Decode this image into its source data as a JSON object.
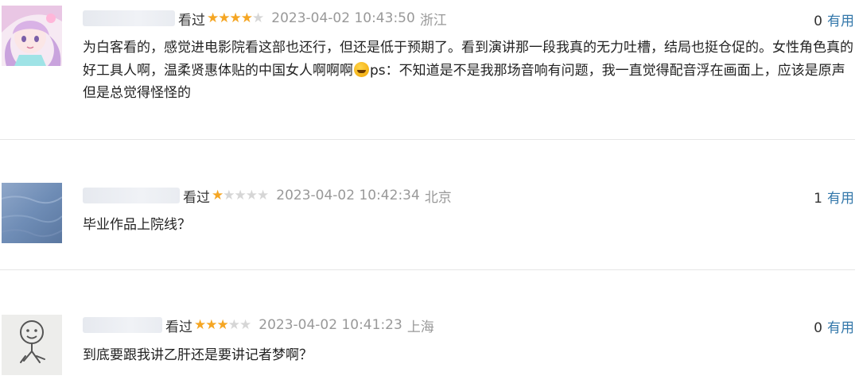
{
  "comments": [
    {
      "avatar_icon": "anime-girl-avatar-icon",
      "status": "看过",
      "rating": 4,
      "time": "2023-04-02 10:43:50",
      "location": "浙江",
      "useful_count": "0",
      "useful_label": "有用",
      "content_before_emoji": "为白客看的，感觉进电影院看这部也还行，但还是低于预期了。看到演讲那一段我真的无力吐槽，结局也挺仓促的。女性角色真的好工具人啊，温柔贤惠体贴的中国女人啊啊啊",
      "emoji_icon": "grinning-sweat-emoji-icon",
      "content_after_emoji": "ps：不知道是不是我那场音响有问题，我一直觉得配音浮在画面上，应该是原声但是总觉得怪怪的"
    },
    {
      "avatar_icon": "blue-texture-avatar-icon",
      "status": "看过",
      "rating": 1,
      "time": "2023-04-02 10:42:34",
      "location": "北京",
      "useful_count": "1",
      "useful_label": "有用",
      "content": "毕业作品上院线？"
    },
    {
      "avatar_icon": "doodle-face-avatar-icon",
      "status": "看过",
      "rating": 3,
      "time": "2023-04-02 10:41:23",
      "location": "上海",
      "useful_count": "0",
      "useful_label": "有用",
      "content": "到底要跟我讲乙肝还是要讲记者梦啊？"
    }
  ],
  "colors": {
    "star_on": "#f5a623",
    "star_off": "#d6d6d6",
    "vote_link": "#3377aa",
    "meta_gray": "#999999"
  }
}
